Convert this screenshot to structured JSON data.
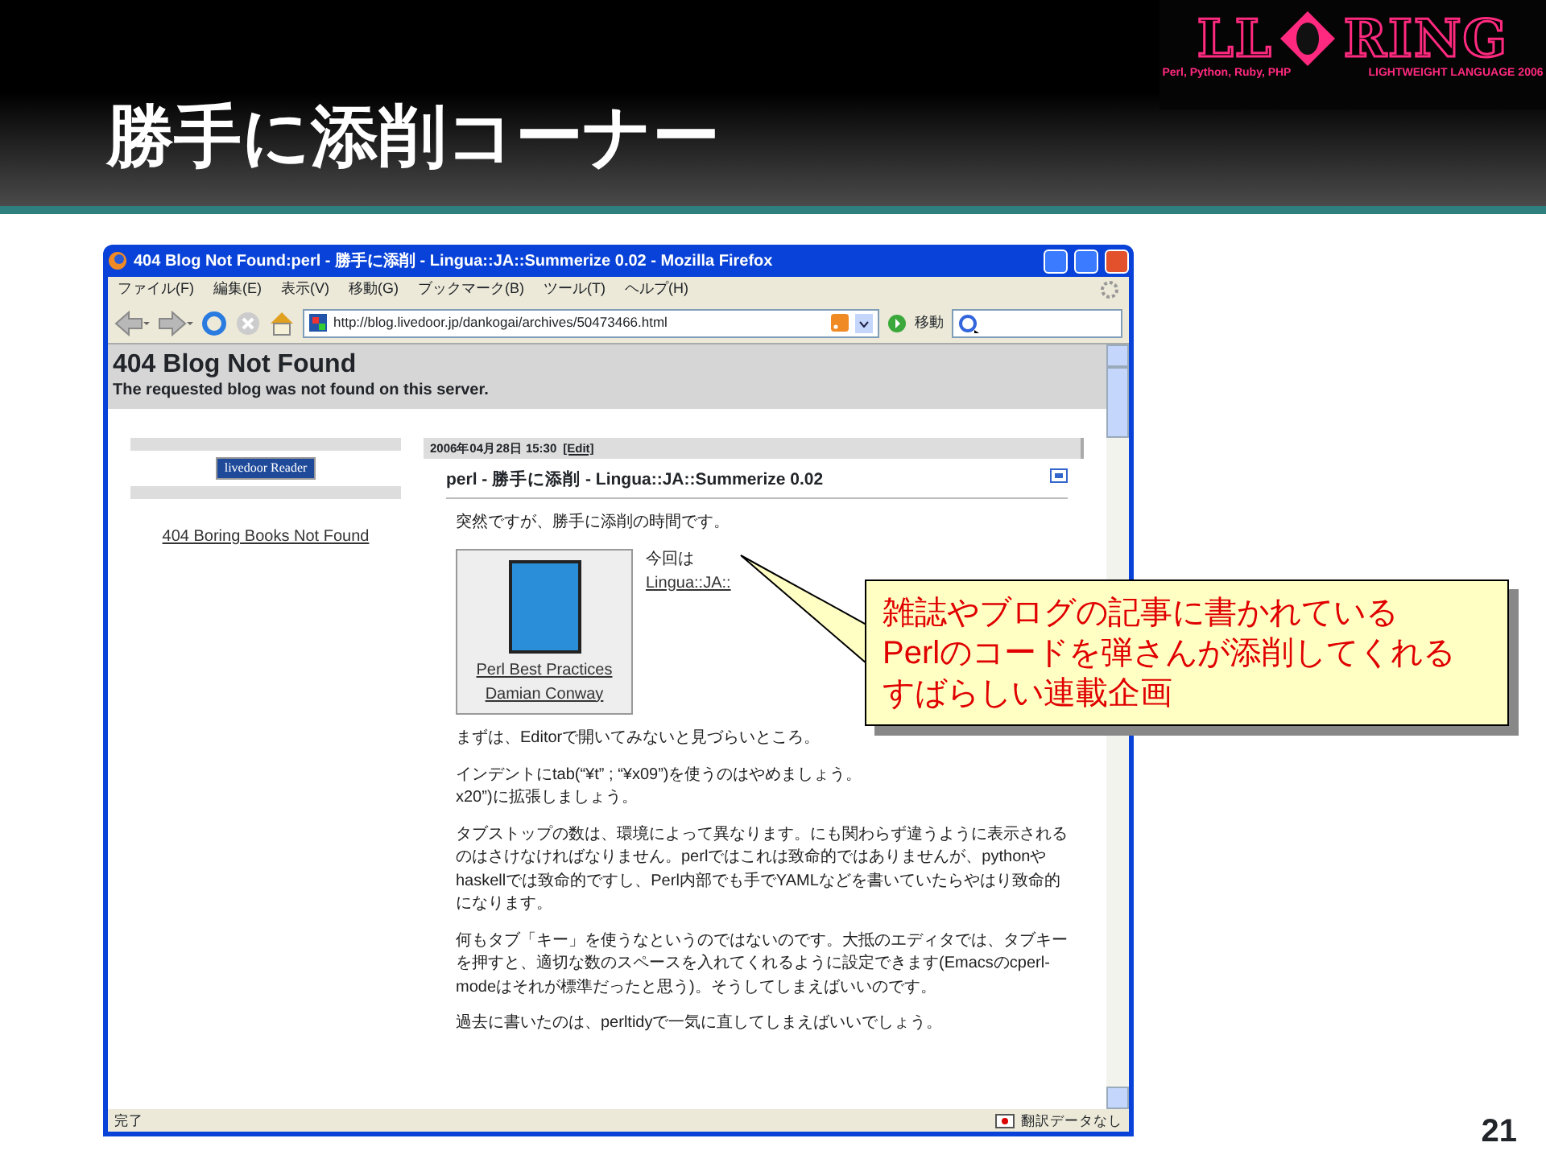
{
  "slide": {
    "title": "勝手に添削コーナー",
    "page_number": "21"
  },
  "logo": {
    "left_word": "LL",
    "right_word": "RING",
    "tagline_left": "Perl, Python, Ruby, PHP",
    "tagline_right": "LIGHTWEIGHT LANGUAGE 2006"
  },
  "browser": {
    "title": "404 Blog Not Found:perl - 勝手に添削 - Lingua::JA::Summerize 0.02 - Mozilla Firefox",
    "menu": [
      "ファイル(F)",
      "編集(E)",
      "表示(V)",
      "移動(G)",
      "ブックマーク(B)",
      "ツール(T)",
      "ヘルプ(H)"
    ],
    "address": "http://blog.livedoor.jp/dankogai/archives/50473466.html",
    "go_label": "移動",
    "page": {
      "error_title": "404 Blog Not Found",
      "error_text": "The requested blog was not found on this server.",
      "sidebar": {
        "badge": "livedoor Reader",
        "link": "404 Boring Books Not Found"
      },
      "post": {
        "date": "2006年04月28日 15:30",
        "edit": "[Edit]",
        "title": "perl - 勝手に添削 - Lingua::JA::Summerize 0.02",
        "intro": "突然ですが、勝手に添削の時間です。",
        "book": {
          "title": "Perl Best Practices",
          "author": "Damian Conway"
        },
        "aside": {
          "text": "今回は",
          "link": "Lingua::JA::"
        },
        "paragraphs": [
          {
            "lines": [
              "まずは、Editorで開いてみないと見づらいところ。"
            ]
          },
          {
            "lines": [
              "インデントにtab(“¥t” ; “¥x09”)を使うのはやめましょう。",
              "x20”)に拡張しましょう。"
            ]
          },
          {
            "lines": [
              "タブストップの数は、環境によって異なります。にも関わらず違うように表示されるのはさけなければなりません。perlではこれは致命的ではありませんが、pythonやhaskellでは致命的ですし、Perl内部でも手でYAMLなどを書いていたらやはり致命的になります。"
            ]
          },
          {
            "lines": [
              "何もタブ「キー」を使うなというのではないのです。大抵のエディタでは、タブキーを押すと、適切な数のスペースを入れてくれるように設定できます(Emacsのcperl-modeはそれが標準だったと思う)。そうしてしまえばいいのです。"
            ]
          },
          {
            "lines": [
              "過去に書いたのは、perltidyで一気に直してしまえばいいでしょう。"
            ]
          }
        ]
      }
    },
    "status": {
      "text": "完了",
      "translation": "翻訳データなし"
    }
  },
  "callout": {
    "lines": [
      "雑誌やブログの記事に書かれている",
      "Perlのコードを弾さんが添削してくれる",
      "すばらしい連載企画"
    ]
  }
}
